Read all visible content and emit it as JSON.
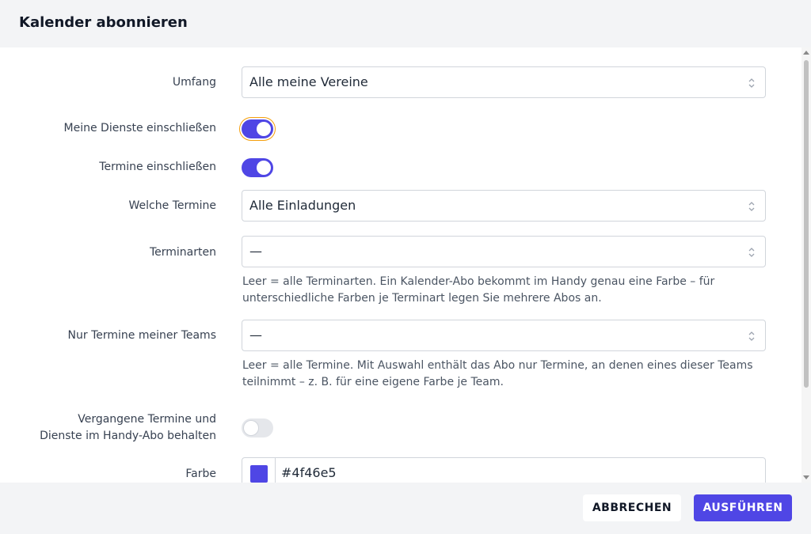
{
  "dialog": {
    "title": "Kalender abonnieren"
  },
  "form": {
    "scope": {
      "label": "Umfang",
      "value": "Alle meine Vereine"
    },
    "include_duties": {
      "label": "Meine Dienste einschließen",
      "on": true
    },
    "include_events": {
      "label": "Termine einschließen",
      "on": true
    },
    "which_events": {
      "label": "Welche Termine",
      "value": "Alle Einladungen"
    },
    "event_types": {
      "label": "Terminarten",
      "value": "—",
      "hint": "Leer = alle Terminarten. Ein Kalender-Abo bekommt im Handy genau eine Farbe – für unterschiedliche Farben je Terminart legen Sie mehrere Abos an."
    },
    "teams": {
      "label": "Nur Termine meiner Teams",
      "value": "—",
      "hint": "Leer = alle Termine. Mit Auswahl enthält das Abo nur Termine, an denen eines dieser Teams teilnimmt – z. B. für eine eigene Farbe je Team."
    },
    "keep_past": {
      "label_line1": "Vergangene Termine und",
      "label_line2": "Dienste im Handy-Abo behalten",
      "on": false
    },
    "color": {
      "label": "Farbe",
      "value": "#4f46e5"
    }
  },
  "footer": {
    "cancel_label": "ABBRECHEN",
    "submit_label": "AUSFÜHREN"
  },
  "colors": {
    "accent": "#4f46e5",
    "focus_ring": "#f59e0b"
  }
}
